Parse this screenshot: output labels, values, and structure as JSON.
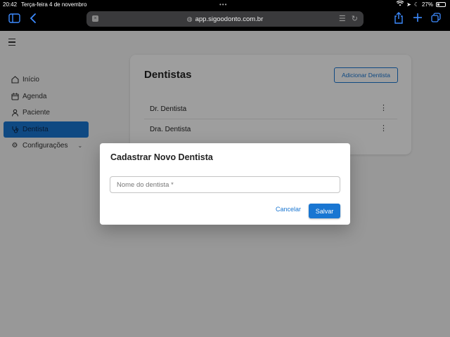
{
  "status_bar": {
    "time": "20:42",
    "date": "Terça-feira 4 de novembro",
    "battery": "27%",
    "battery_level": 0.27
  },
  "browser": {
    "url": "app.sigoodonto.com.br"
  },
  "sidebar": {
    "items": [
      {
        "label": "Início",
        "icon": "home-icon",
        "active": false
      },
      {
        "label": "Agenda",
        "icon": "calendar-icon",
        "active": false
      },
      {
        "label": "Paciente",
        "icon": "person-icon",
        "active": false
      },
      {
        "label": "Dentista",
        "icon": "stethoscope-icon",
        "active": true
      },
      {
        "label": "Configurações",
        "icon": "gear-icon",
        "active": false
      }
    ]
  },
  "main": {
    "title": "Dentistas",
    "add_button": "Adicionar Dentista",
    "dentists": [
      "Dr. Dentista",
      "Dra. Dentista"
    ]
  },
  "dialog": {
    "title": "Cadastrar Novo Dentista",
    "input_placeholder": "Nome do dentista *",
    "input_value": "",
    "cancel_label": "Cancelar",
    "save_label": "Salvar"
  },
  "colors": {
    "primary": "#1976d2",
    "ios_blue": "#3d8bff"
  }
}
